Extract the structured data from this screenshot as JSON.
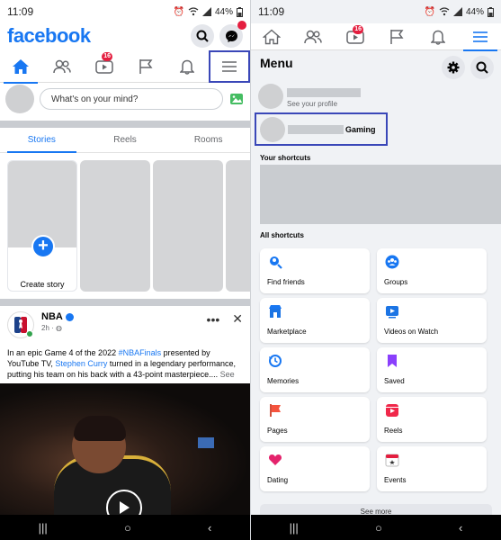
{
  "left": {
    "status": {
      "time": "11:09",
      "battery": "44%"
    },
    "header": {
      "logo": "facebook",
      "messenger_badge": ""
    },
    "tabs": [
      {
        "icon": "home-icon",
        "active": true
      },
      {
        "icon": "friends-icon"
      },
      {
        "icon": "watch-icon",
        "badge": "16"
      },
      {
        "icon": "pages-flag-icon"
      },
      {
        "icon": "bell-icon"
      },
      {
        "icon": "menu-icon",
        "highlighted": true
      }
    ],
    "composer": {
      "placeholder": "What's on your mind?"
    },
    "story_tabs": [
      "Stories",
      "Reels",
      "Rooms"
    ],
    "create_story": "Create story",
    "post": {
      "author": "NBA",
      "time": "2h",
      "text_prefix": "In an epic Game 4 of the 2022 ",
      "hashtag": "#NBAFinals",
      "text_mid": " presented by YouTube TV, ",
      "mention": "Stephen Curry",
      "text_suffix": " turned in a legendary performance, putting his team on his back with a 43-point masterpiece....",
      "see_more": "See more",
      "more_icon": "•••",
      "close_icon": "✕"
    },
    "nav": {
      "recents": "|||",
      "home": "○",
      "back": "‹"
    }
  },
  "right": {
    "status": {
      "time": "11:09",
      "battery": "44%"
    },
    "tabs": [
      {
        "icon": "home-icon"
      },
      {
        "icon": "friends-icon"
      },
      {
        "icon": "watch-icon",
        "badge": "16"
      },
      {
        "icon": "pages-flag-icon"
      },
      {
        "icon": "bell-icon"
      },
      {
        "icon": "menu-icon",
        "active": true
      }
    ],
    "menu_title": "Menu",
    "see_profile": "See your profile",
    "gaming": "Gaming",
    "your_shortcuts": "Your shortcuts",
    "all_shortcuts": "All shortcuts",
    "shortcuts": [
      {
        "label": "Find friends",
        "icon": "find-friends-icon",
        "color": "#1877f2"
      },
      {
        "label": "Groups",
        "icon": "groups-icon",
        "color": "#1877f2"
      },
      {
        "label": "Marketplace",
        "icon": "marketplace-icon",
        "color": "#1877f2"
      },
      {
        "label": "Videos on Watch",
        "icon": "videos-icon",
        "color": "#1b74e4"
      },
      {
        "label": "Memories",
        "icon": "memories-icon",
        "color": "#1877f2"
      },
      {
        "label": "Saved",
        "icon": "saved-icon",
        "color": "#8a3ffc"
      },
      {
        "label": "Pages",
        "icon": "pages-icon",
        "color": "#f5533d"
      },
      {
        "label": "Reels",
        "icon": "reels-icon",
        "color": "#f0284a"
      },
      {
        "label": "Dating",
        "icon": "dating-icon",
        "color": "#e4236c"
      },
      {
        "label": "Events",
        "icon": "events-icon",
        "color": "#e41e3f"
      }
    ],
    "see_more": "See more",
    "nav": {
      "recents": "|||",
      "home": "○",
      "back": "‹"
    }
  }
}
